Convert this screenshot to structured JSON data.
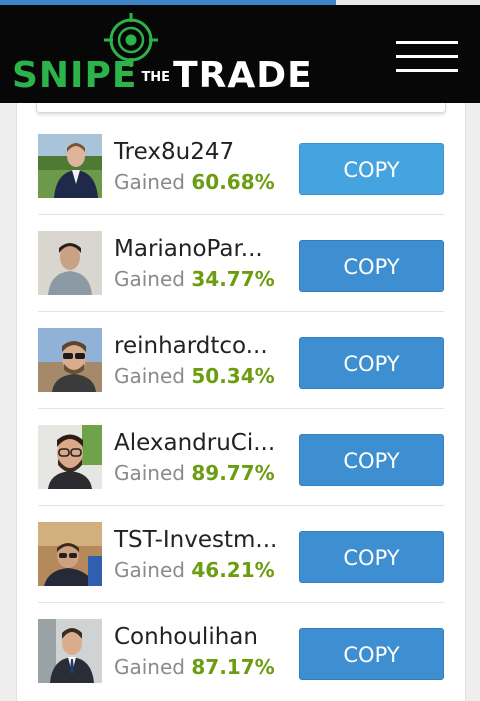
{
  "app": {
    "logo": {
      "word1": "SNIPE",
      "word2": "THE",
      "word3": "TRADE",
      "green": "#2cb34a"
    },
    "menu_icon": "hamburger-menu-icon",
    "progress_fraction": 0.7
  },
  "labels": {
    "gained": "Gained",
    "copy": "COPY"
  },
  "traders": [
    {
      "name": "Trex8u247",
      "gain": "60.68%"
    },
    {
      "name": "MarianoPar...",
      "gain": "34.77%"
    },
    {
      "name": "reinhardtco...",
      "gain": "50.34%"
    },
    {
      "name": "AlexandruCi...",
      "gain": "89.77%"
    },
    {
      "name": "TST-Investm...",
      "gain": "46.21%"
    },
    {
      "name": "Conhoulihan",
      "gain": "87.17%"
    }
  ],
  "colors": {
    "gain": "#6b9d10",
    "button": "#3d8fd1",
    "header": "#070707"
  }
}
